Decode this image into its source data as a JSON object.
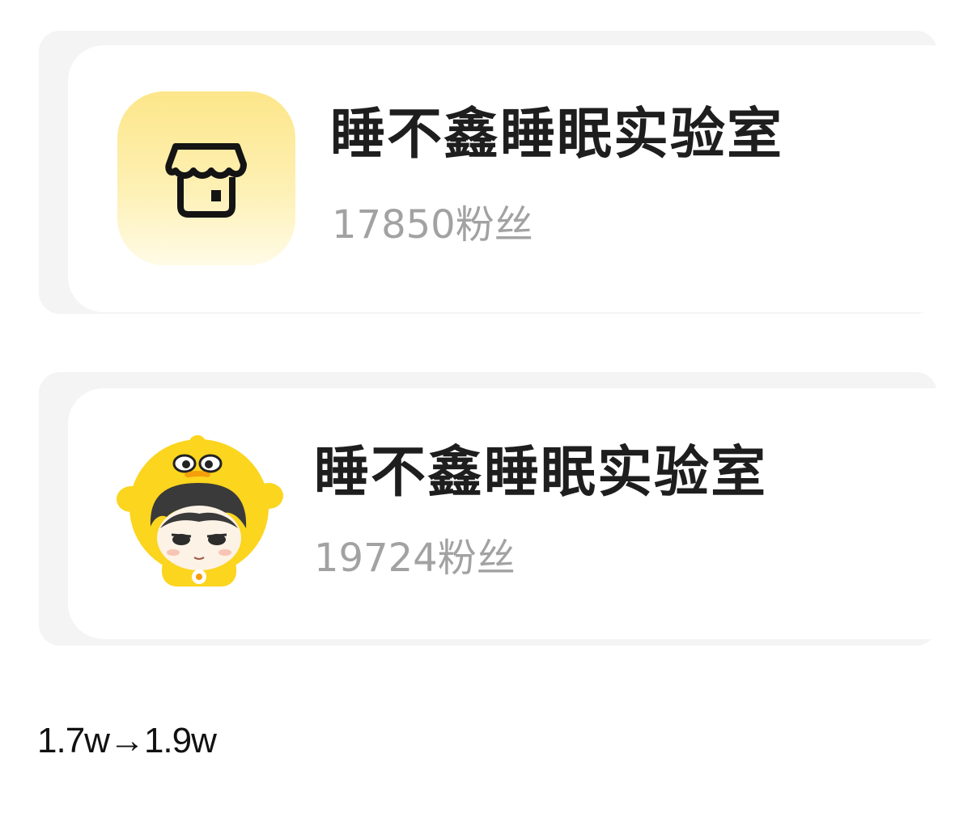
{
  "stores": [
    {
      "name": "睡不鑫睡眠实验室",
      "fans": "17850粉丝",
      "avatar_icon": "shop-icon"
    },
    {
      "name": "睡不鑫睡眠实验室",
      "fans": "19724粉丝",
      "avatar_icon": "duck-mascot-avatar"
    }
  ],
  "caption": "1.7w→1.9w",
  "colors": {
    "name_text": "#1e1e1e",
    "fans_text": "#a2a2a2",
    "avatar_yellow": "#fde68a",
    "mascot_yellow": "#fbd51e"
  }
}
